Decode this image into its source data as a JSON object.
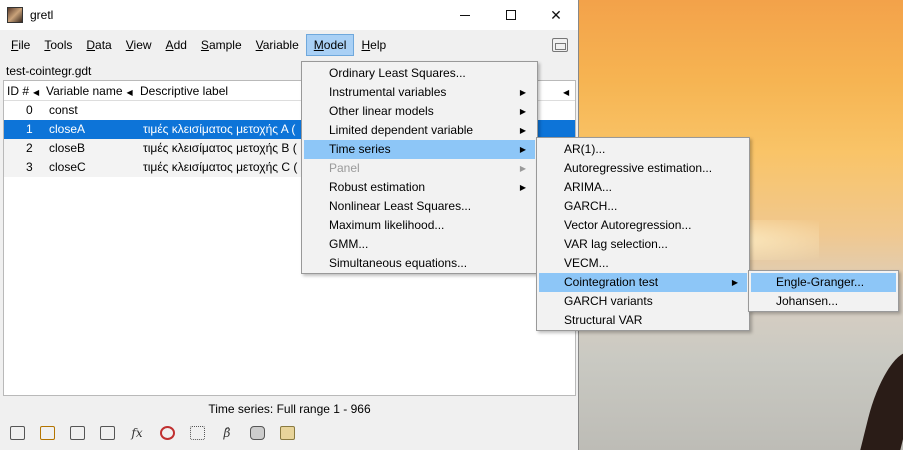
{
  "window": {
    "title": "gretl",
    "menu": [
      "File",
      "Tools",
      "Data",
      "View",
      "Add",
      "Sample",
      "Variable",
      "Model",
      "Help"
    ],
    "menu_underline": [
      "F",
      "T",
      "D",
      "V",
      "A",
      "S",
      "V",
      "M",
      "H"
    ],
    "filename": "test-cointegr.gdt",
    "columns": {
      "id": "ID #",
      "name": "Variable name",
      "label": "Descriptive label"
    },
    "rows": [
      {
        "id": "0",
        "name": "const",
        "label": ""
      },
      {
        "id": "1",
        "name": "closeA",
        "label": "τιμές κλεισίματος μετοχής Α ("
      },
      {
        "id": "2",
        "name": "closeB",
        "label": "τιμές κλεισίματος μετοχής Β ("
      },
      {
        "id": "3",
        "name": "closeC",
        "label": "τιμές κλεισίματος μετοχής C ("
      }
    ],
    "status": "Time series: Full range 1 - 966",
    "toolbar_text": {
      "fx": "fx",
      "beta": "β̂"
    }
  },
  "model_menu": [
    {
      "label": "Ordinary Least Squares...",
      "submenu": false
    },
    {
      "label": "Instrumental variables",
      "submenu": true
    },
    {
      "label": "Other linear models",
      "submenu": true
    },
    {
      "label": "Limited dependent variable",
      "submenu": true
    },
    {
      "label": "Time series",
      "submenu": true,
      "highlight": true
    },
    {
      "label": "Panel",
      "submenu": true,
      "disabled": true
    },
    {
      "label": "Robust estimation",
      "submenu": true
    },
    {
      "label": "Nonlinear Least Squares...",
      "submenu": false
    },
    {
      "label": "Maximum likelihood...",
      "submenu": false
    },
    {
      "label": "GMM...",
      "submenu": false
    },
    {
      "label": "Simultaneous equations...",
      "submenu": false
    }
  ],
  "ts_menu": [
    {
      "label": "AR(1)...",
      "submenu": false
    },
    {
      "label": "Autoregressive estimation...",
      "submenu": false
    },
    {
      "label": "ARIMA...",
      "submenu": false
    },
    {
      "label": "GARCH...",
      "submenu": false
    },
    {
      "label": "Vector Autoregression...",
      "submenu": false
    },
    {
      "label": "VAR lag selection...",
      "submenu": false
    },
    {
      "label": "VECM...",
      "submenu": false
    },
    {
      "label": "Cointegration test",
      "submenu": true,
      "highlight": true
    },
    {
      "label": "GARCH variants",
      "submenu": false
    },
    {
      "label": "Structural VAR",
      "submenu": false
    }
  ],
  "coint_menu": [
    {
      "label": "Engle-Granger...",
      "highlight": true
    },
    {
      "label": "Johansen..."
    }
  ],
  "colors": {
    "selection": "#0d74d8",
    "menu_highlight": "#8dc6f7"
  }
}
